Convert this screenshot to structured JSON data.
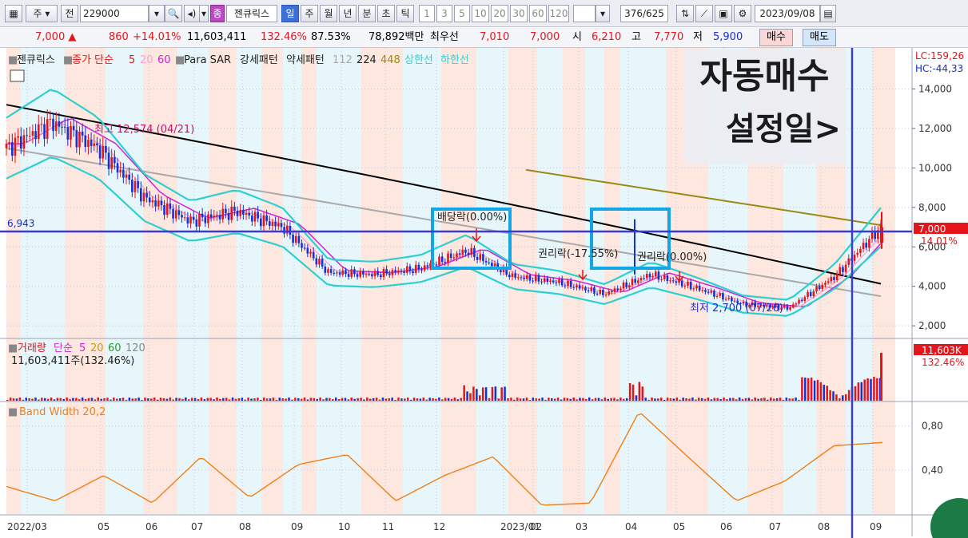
{
  "toolbar": {
    "market": "주",
    "view": "전",
    "code": "229000",
    "stock_name": "젠큐릭스",
    "stock_badge": "종",
    "periods": [
      "일",
      "주",
      "월",
      "년",
      "분",
      "초",
      "틱"
    ],
    "active_period": "일",
    "intervals": [
      "1",
      "3",
      "5",
      "10",
      "20",
      "30",
      "60",
      "120"
    ],
    "page_counter": "376/625",
    "date": "2023/09/08"
  },
  "quote": {
    "price": "7,000",
    "change": "860",
    "change_pct": "+14.01%",
    "volume": "11,603,411",
    "volume_ratio": "132.46%",
    "rotation": "87.53%",
    "amount": "78,892백만",
    "high_label": "최우선",
    "best_ask": "7,010",
    "best_bid": "7,000",
    "open_label": "시",
    "open": "6,210",
    "high_label2": "고",
    "high": "7,770",
    "low_label": "저",
    "low": "5,900",
    "buy_button": "매수",
    "sell_button": "매도"
  },
  "overlay_note": {
    "line1": "자동매수",
    "line2": "설정일>"
  },
  "colors": {
    "up": "#e4151b",
    "down": "#1430d6",
    "ma5": "#ff6a8a",
    "ma20": "#ff9ecf",
    "ma60": "#d420d8",
    "ma224": "#000000",
    "ma112": "#a9a9a9",
    "ma448": "#9c8a18",
    "envelope": "#2fcfcf",
    "highlight_box": "#13a6e6",
    "crosshair": "#3a3ad6",
    "band_width": "#f07f18",
    "bg_up": "#fde4da",
    "bg_down": "#e3f5fb"
  },
  "chart_data": [
    {
      "type": "candlestick",
      "panel": "price",
      "legend": {
        "name": "젠큐릭스",
        "close_ma": "종가 단순",
        "ma_periods": [
          "5",
          "20",
          "60"
        ],
        "para_sar": "Para SAR",
        "strong_pattern": "강세패턴",
        "weak_pattern": "약세패턴",
        "long_ma_periods": [
          "112",
          "224",
          "448"
        ],
        "upper_band": "상한선",
        "lower_band": "하한선"
      },
      "y_ticks": [
        "2,000",
        "4,000",
        "6,000",
        "8,000",
        "10,000",
        "12,000",
        "14,000"
      ],
      "ylim": [
        1400,
        16000
      ],
      "x_labels": [
        "2022/03",
        "05",
        "06",
        "07",
        "08",
        "09",
        "10",
        "11",
        "12",
        "2023/01",
        "02",
        "03",
        "04",
        "05",
        "06",
        "07",
        "08",
        "09"
      ],
      "close_series_approx": [
        {
          "date": "2022/03",
          "value": 11000
        },
        {
          "date": "2022/04",
          "value": 12300
        },
        {
          "date": "2022/05",
          "value": 11000
        },
        {
          "date": "2022/06",
          "value": 8500
        },
        {
          "date": "2022/07",
          "value": 7300
        },
        {
          "date": "2022/08",
          "value": 7800
        },
        {
          "date": "2022/09",
          "value": 7000
        },
        {
          "date": "2022/10",
          "value": 4700
        },
        {
          "date": "2022/11",
          "value": 4600
        },
        {
          "date": "2022/12",
          "value": 4900
        },
        {
          "date": "2022/12",
          "value": 5800
        },
        {
          "date": "2023/01",
          "value": 4500
        },
        {
          "date": "2023/02",
          "value": 4200
        },
        {
          "date": "2023/03",
          "value": 3600
        },
        {
          "date": "2023/04",
          "value": 4600
        },
        {
          "date": "2023/05",
          "value": 3900
        },
        {
          "date": "2023/06",
          "value": 3100
        },
        {
          "date": "2023/07",
          "value": 2900
        },
        {
          "date": "2023/08",
          "value": 4500
        },
        {
          "date": "2023/09",
          "value": 7000
        }
      ],
      "annotations": {
        "high": "최고 12,574 (04/21)",
        "low": "최저 2,700 (07/26)",
        "dividend": "배당락(0.00%)",
        "rights": "권리락(-17.55%)",
        "rights2": "권리락(0.00%)",
        "crosshair_value": "6,943",
        "lc": "LC:159,26",
        "hc": "HC:-44,33",
        "last_price_tag": "7,000",
        "last_pct_tag": "14.01%"
      }
    },
    {
      "type": "bar",
      "panel": "volume",
      "legend": {
        "name": "거래량",
        "ma_label": "단순",
        "ma_periods": [
          "5",
          "20",
          "60",
          "120"
        ],
        "value_text": "11,603,411주(132.46%)"
      },
      "last_tag": "11,603K",
      "last_pct_tag": "132.46%",
      "volume_series_approx": [
        {
          "date": "2022/12",
          "value": 0.35
        },
        {
          "date": "2023/04",
          "value": 0.45
        },
        {
          "date": "2023/08",
          "value": 0.6
        },
        {
          "date": "2023/09",
          "value": 1.0
        }
      ]
    },
    {
      "type": "line",
      "panel": "band_width",
      "legend": {
        "name": "Band Width 20,2"
      },
      "y_ticks": [
        "0,40",
        "0,80"
      ],
      "ylim": [
        0.0,
        1.0
      ],
      "series": [
        {
          "name": "Band Width 20,2",
          "values_approx": [
            {
              "date": "2022/03",
              "value": 0.25
            },
            {
              "date": "2022/04",
              "value": 0.12
            },
            {
              "date": "2022/05",
              "value": 0.35
            },
            {
              "date": "2022/06",
              "value": 0.1
            },
            {
              "date": "2022/07",
              "value": 0.52
            },
            {
              "date": "2022/08",
              "value": 0.15
            },
            {
              "date": "2022/09",
              "value": 0.45
            },
            {
              "date": "2022/10",
              "value": 0.54
            },
            {
              "date": "2022/11",
              "value": 0.12
            },
            {
              "date": "2022/12",
              "value": 0.35
            },
            {
              "date": "2023/01",
              "value": 0.52
            },
            {
              "date": "2023/02",
              "value": 0.08
            },
            {
              "date": "2023/03",
              "value": 0.1
            },
            {
              "date": "2023/04",
              "value": 0.93
            },
            {
              "date": "2023/05",
              "value": 0.52
            },
            {
              "date": "2023/06",
              "value": 0.12
            },
            {
              "date": "2023/07",
              "value": 0.3
            },
            {
              "date": "2023/08",
              "value": 0.62
            },
            {
              "date": "2023/09",
              "value": 0.65
            }
          ]
        }
      ]
    }
  ]
}
